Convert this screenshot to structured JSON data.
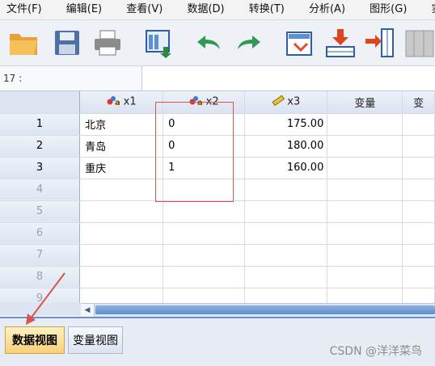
{
  "menu": [
    "文件(F)",
    "编辑(E)",
    "查看(V)",
    "数据(D)",
    "转换(T)",
    "分析(A)",
    "图形(G)",
    "实"
  ],
  "toolbar": {
    "icons": [
      "open-folder-icon",
      "save-icon",
      "print-icon",
      "dialog-recall-icon",
      "undo-icon",
      "redo-icon",
      "goto-case-icon",
      "insert-cases-icon",
      "insert-variable-icon",
      "split-file-icon"
    ]
  },
  "refbar": {
    "cell_ref": "17 :"
  },
  "grid": {
    "columns": [
      {
        "label": "x1",
        "icon": "nominal-string-icon"
      },
      {
        "label": "x2",
        "icon": "nominal-numeric-icon"
      },
      {
        "label": "x3",
        "icon": "scale-ruler-icon"
      },
      {
        "label": "变量",
        "icon": ""
      },
      {
        "label": "变",
        "icon": ""
      }
    ],
    "rows": [
      {
        "num": "1",
        "x1": "北京",
        "x2": "0",
        "x3": "175.00"
      },
      {
        "num": "2",
        "x1": "青岛",
        "x2": "0",
        "x3": "180.00"
      },
      {
        "num": "3",
        "x1": "重庆",
        "x2": "1",
        "x3": "160.00"
      },
      {
        "num": "4",
        "x1": "",
        "x2": "",
        "x3": ""
      },
      {
        "num": "5",
        "x1": "",
        "x2": "",
        "x3": ""
      },
      {
        "num": "6",
        "x1": "",
        "x2": "",
        "x3": ""
      },
      {
        "num": "7",
        "x1": "",
        "x2": "",
        "x3": ""
      },
      {
        "num": "8",
        "x1": "",
        "x2": "",
        "x3": ""
      },
      {
        "num": "9",
        "x1": "",
        "x2": "",
        "x3": ""
      }
    ]
  },
  "tabs": {
    "data_view": "数据视图",
    "variable_view": "变量视图"
  },
  "watermark": "CSDN @洋洋菜鸟",
  "colors": {
    "accent": "#6a8fc7",
    "active_tab": "#f7d27a",
    "annotation": "#d9534f"
  }
}
